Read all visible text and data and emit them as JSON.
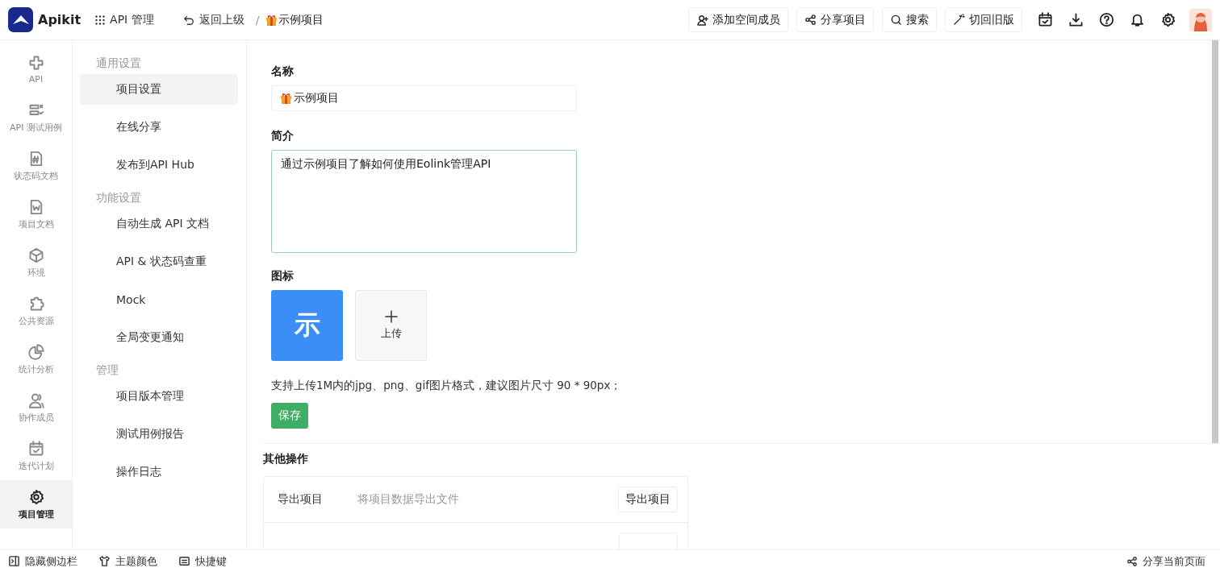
{
  "header": {
    "logo": "Apikit",
    "module_menu": "API 管理",
    "back": "返回上级",
    "separator": "/",
    "project": "示例项目",
    "buttons": [
      {
        "label": "添加空间成员",
        "kind": "add-user"
      },
      {
        "label": "分享项目",
        "kind": "share"
      },
      {
        "label": "搜索",
        "kind": "search"
      },
      {
        "label": "切回旧版",
        "kind": "wand"
      }
    ],
    "icons": [
      {
        "kind": "calendar"
      },
      {
        "kind": "download"
      },
      {
        "kind": "help"
      },
      {
        "kind": "bell"
      },
      {
        "kind": "settings"
      },
      {
        "kind": "avatar"
      }
    ]
  },
  "rail": [
    {
      "label": "API",
      "kind": "api",
      "selected": false
    },
    {
      "label": "API 测试用例",
      "kind": "tests",
      "selected": false
    },
    {
      "label": "状态码文档",
      "kind": "hash",
      "selected": false
    },
    {
      "label": "项目文档",
      "kind": "word",
      "selected": false
    },
    {
      "label": "环境",
      "kind": "cube",
      "selected": false
    },
    {
      "label": "公共资源",
      "kind": "puzzle",
      "selected": false
    },
    {
      "label": "统计分析",
      "kind": "pie",
      "selected": false
    },
    {
      "label": "协作成员",
      "kind": "users",
      "selected": false
    },
    {
      "label": "迭代计划",
      "kind": "calendar",
      "selected": false
    },
    {
      "label": "项目管理",
      "kind": "settings",
      "selected": true
    }
  ],
  "menu": [
    {
      "heading": "通用设置",
      "items": [
        {
          "label": "项目设置",
          "selected": true
        },
        {
          "label": "在线分享",
          "selected": false
        },
        {
          "label": "发布到API Hub",
          "selected": false
        }
      ]
    },
    {
      "heading": "功能设置",
      "items": [
        {
          "label": "自动生成 API 文档",
          "selected": false
        },
        {
          "label": "API & 状态码查重",
          "selected": false
        },
        {
          "label": "Mock",
          "selected": false
        },
        {
          "label": "全局变更通知",
          "selected": false
        }
      ]
    },
    {
      "heading": "管理",
      "items": [
        {
          "label": "项目版本管理",
          "selected": false
        },
        {
          "label": "测试用例报告",
          "selected": false
        },
        {
          "label": "操作日志",
          "selected": false
        }
      ]
    }
  ],
  "form": {
    "name_label": "名称",
    "name_value": "示例项目",
    "intro_label": "简介",
    "intro_value": "通过示例项目了解如何使用Eolink管理API",
    "icon_label": "图标",
    "icon_char": "示",
    "upload_label": "上传",
    "hint": "支持上传1M内的jpg、png、gif图片格式，建议图片尺寸 90 * 90px；",
    "save": "保存"
  },
  "other": {
    "title": "其他操作",
    "rows": [
      {
        "name": "导出项目",
        "description": "将项目数据导出文件",
        "action": "导出项目"
      }
    ]
  },
  "footer": {
    "items": [
      {
        "label": "隐藏侧边栏",
        "kind": "sidebar"
      },
      {
        "label": "主题颜色",
        "kind": "shirt"
      },
      {
        "label": "快捷键",
        "kind": "keyboard"
      }
    ],
    "share": "分享当前页面"
  }
}
